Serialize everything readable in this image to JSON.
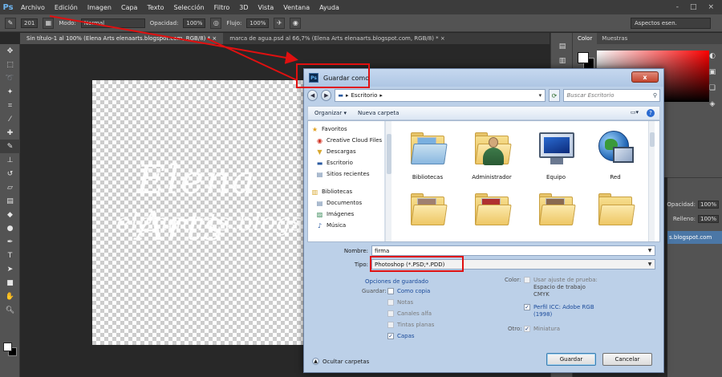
{
  "app": {
    "logo": "Ps",
    "menu": [
      "Archivo",
      "Edición",
      "Imagen",
      "Capa",
      "Texto",
      "Selección",
      "Filtro",
      "3D",
      "Vista",
      "Ventana",
      "Ayuda"
    ],
    "window_controls": [
      "-",
      "□",
      "×"
    ]
  },
  "options_bar": {
    "brush_size": "201",
    "mode_label": "Modo:",
    "mode_value": "Normal",
    "opacity_label": "Opacidad:",
    "opacity_value": "100%",
    "flow_label": "Flujo:",
    "flow_value": "100%",
    "workspace": "Aspectos esen."
  },
  "tabs": [
    {
      "label": "Sin título-1 al 100% (Elena Arts elenaarts.blogspot.com, RGB/8) *  ×",
      "active": true
    },
    {
      "label": "marca de agua.psd al 66,7% (Elena Arts elenaarts.blogspot.com, RGB/8) *  ×",
      "active": false
    }
  ],
  "canvas": {
    "watermark_line1": "Elena Arts",
    "watermark_line2": "elenaarts.blogspot.com"
  },
  "color_panel": {
    "tabs": [
      "Color",
      "Muestras"
    ]
  },
  "layers_panel": {
    "opacity_label": "Opacidad:",
    "opacity_value": "100%",
    "fill_label": "Relleno:",
    "fill_value": "100%",
    "layer_name": "s.blogspot.com"
  },
  "dialog": {
    "title": "Guardar como",
    "close": "x",
    "location": "Escritorio",
    "search_placeholder": "Buscar Escritorio",
    "organize": "Organizar ▾",
    "new_folder": "Nueva carpeta",
    "nav": {
      "favorites_header": "Favoritos",
      "favorites": [
        "Creative Cloud Files",
        "Descargas",
        "Escritorio",
        "Sitios recientes"
      ],
      "libraries_header": "Bibliotecas",
      "libraries": [
        "Documentos",
        "Imágenes",
        "Música"
      ]
    },
    "files": [
      "Bibliotecas",
      "Administrador",
      "Equipo",
      "Red"
    ],
    "name_label": "Nombre:",
    "name_value": "firma",
    "type_label": "Tipo:",
    "type_value": "Photoshop (*.PSD;*.PDD)",
    "save_options_header": "Opciones de guardado",
    "save_label": "Guardar:",
    "save_options": [
      {
        "label": "Como copia",
        "checked": false,
        "enabled": true
      },
      {
        "label": "Notas",
        "checked": false,
        "enabled": false
      },
      {
        "label": "Canales alfa",
        "checked": false,
        "enabled": false
      },
      {
        "label": "Tintas planas",
        "checked": false,
        "enabled": false
      },
      {
        "label": "Capas",
        "checked": true,
        "enabled": true
      }
    ],
    "color_label": "Color:",
    "proof_label": "Usar ajuste de prueba:",
    "proof_sub1": "Espacio de trabajo",
    "proof_sub2": "CMYK",
    "icc_label": "Perfil ICC: Adobe RGB",
    "icc_sub": "(1998)",
    "other_label": "Otro:",
    "thumbnail_label": "Miniatura",
    "hide_folders": "Ocultar carpetas",
    "save_button": "Guardar",
    "cancel_button": "Cancelar"
  }
}
